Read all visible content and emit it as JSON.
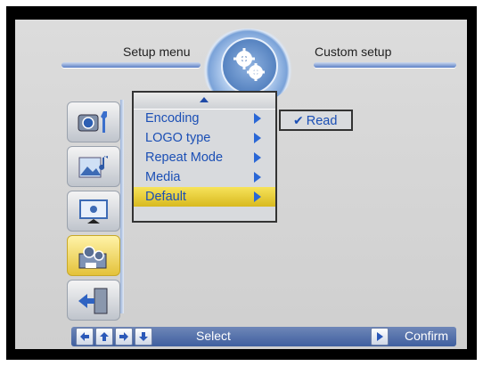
{
  "header": {
    "left_title": "Setup menu",
    "right_title": "Custom setup"
  },
  "icons": {
    "emblem": "gears-icon",
    "sidebar": [
      "camera-wrench-icon",
      "picture-music-icon",
      "slideshow-icon",
      "gears-folder-icon",
      "exit-door-icon"
    ],
    "active_sidebar_index": 3
  },
  "menu": {
    "scroll_indicator": "up-arrow",
    "items": [
      {
        "label": "Encoding"
      },
      {
        "label": "LOGO type"
      },
      {
        "label": "Repeat Mode"
      },
      {
        "label": "Media"
      },
      {
        "label": "Default"
      }
    ],
    "selected_index": 4
  },
  "submenu": {
    "check": "✔",
    "label": "Read"
  },
  "footer": {
    "select_label": "Select",
    "confirm_label": "Confirm"
  },
  "colors": {
    "menu_text": "#1b4fb5",
    "highlight": "#f0d53a",
    "bar": "#4f6aa8"
  }
}
